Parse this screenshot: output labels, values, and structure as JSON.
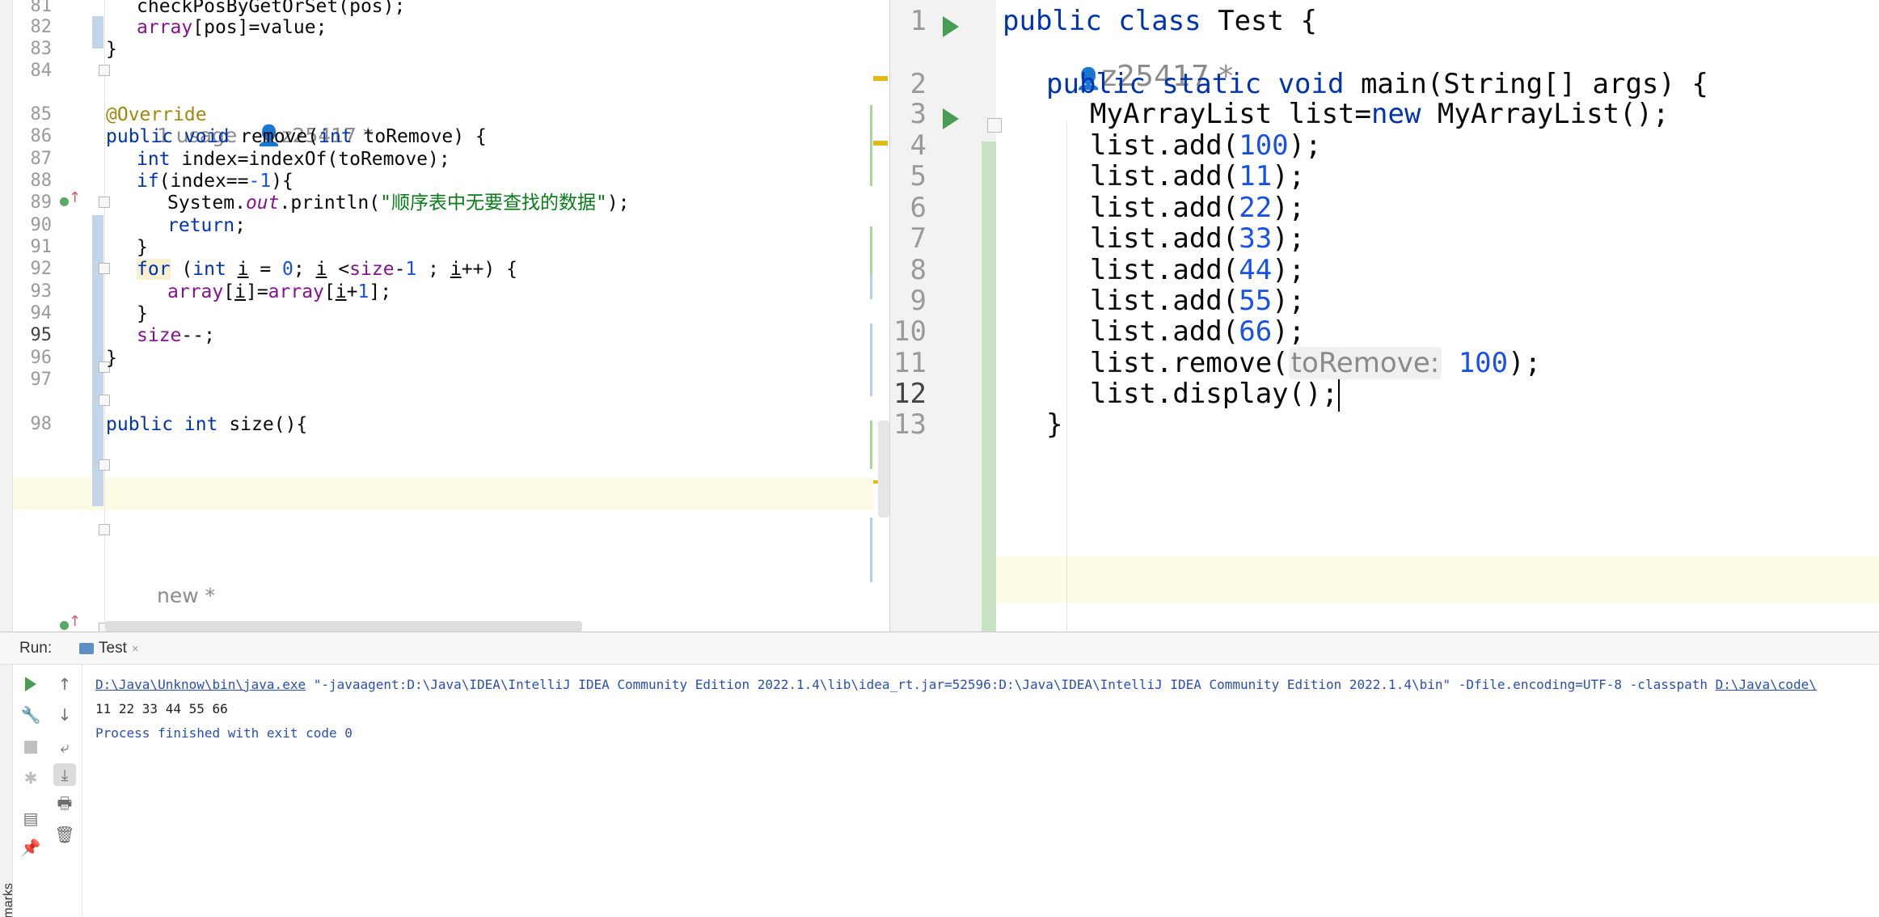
{
  "left_editor": {
    "lines": [
      {
        "no": "81",
        "code": [
          {
            "t": "checkPosByGetOrSet(pos);"
          }
        ]
      },
      {
        "no": "82",
        "code": [
          {
            "t": "array",
            "c": "fld"
          },
          {
            "t": "[pos]=value;"
          }
        ]
      },
      {
        "no": "83",
        "code": [
          {
            "t": "}"
          }
        ]
      },
      {
        "no": "84",
        "code": []
      },
      {
        "no": "85",
        "code": [
          {
            "t": "@Override",
            "c": "ann"
          }
        ]
      },
      {
        "no": "86",
        "code": [
          {
            "t": "public void ",
            "c": "kw"
          },
          {
            "t": "remove("
          },
          {
            "t": "int ",
            "c": "kw"
          },
          {
            "t": "toRemove) {"
          }
        ]
      },
      {
        "no": "87",
        "code": [
          {
            "t": "int ",
            "c": "kw"
          },
          {
            "t": "index=indexOf(toRemove);"
          }
        ]
      },
      {
        "no": "88",
        "code": [
          {
            "t": "if",
            "c": "kw"
          },
          {
            "t": "(index=="
          },
          {
            "t": "-1",
            "c": "num"
          },
          {
            "t": "){"
          }
        ]
      },
      {
        "no": "89",
        "code": [
          {
            "t": "System."
          },
          {
            "t": "out",
            "c": "sfld"
          },
          {
            "t": ".println("
          },
          {
            "t": "\"顺序表中无要查找的数据\"",
            "c": "str"
          },
          {
            "t": ");"
          }
        ]
      },
      {
        "no": "90",
        "code": [
          {
            "t": "return",
            "c": "kw"
          },
          {
            "t": ";"
          }
        ]
      },
      {
        "no": "91",
        "code": [
          {
            "t": "}"
          }
        ]
      },
      {
        "no": "92",
        "code": [
          {
            "t": "for",
            "c": "kw hlk"
          },
          {
            "t": " ("
          },
          {
            "t": "int ",
            "c": "kw"
          },
          {
            "t": "i",
            "c": "ul"
          },
          {
            "t": " = "
          },
          {
            "t": "0",
            "c": "num"
          },
          {
            "t": "; "
          },
          {
            "t": "i",
            "c": "ul"
          },
          {
            "t": " <"
          },
          {
            "t": "size",
            "c": "fld"
          },
          {
            "t": "-"
          },
          {
            "t": "1",
            "c": "num"
          },
          {
            "t": " ; "
          },
          {
            "t": "i",
            "c": "ul"
          },
          {
            "t": "++) {"
          }
        ]
      },
      {
        "no": "93",
        "code": [
          {
            "t": "array",
            "c": "fld"
          },
          {
            "t": "["
          },
          {
            "t": "i",
            "c": "ul"
          },
          {
            "t": "]="
          },
          {
            "t": "array",
            "c": "fld"
          },
          {
            "t": "["
          },
          {
            "t": "i",
            "c": "ul"
          },
          {
            "t": "+"
          },
          {
            "t": "1",
            "c": "num"
          },
          {
            "t": "];"
          }
        ]
      },
      {
        "no": "94",
        "code": [
          {
            "t": "}"
          }
        ]
      },
      {
        "no": "95",
        "code": [
          {
            "t": "size",
            "c": "fld"
          },
          {
            "t": "--;"
          }
        ]
      },
      {
        "no": "96",
        "code": [
          {
            "t": "}"
          }
        ]
      },
      {
        "no": "97",
        "code": []
      },
      {
        "no": "98",
        "code": [
          {
            "t": "public int ",
            "c": "kw"
          },
          {
            "t": "size(){"
          }
        ]
      }
    ],
    "inlay_usage": "1 usage",
    "inlay_author": "z25417 *",
    "inlay_new": "new *"
  },
  "right_editor": {
    "lines": [
      {
        "no": "1",
        "code": [
          {
            "t": "public class ",
            "c": "kw"
          },
          {
            "t": "Test {"
          }
        ]
      },
      {
        "no": "2",
        "code": [
          {
            "t": "public static void ",
            "c": "kw"
          },
          {
            "t": "main(String[] args) {"
          }
        ]
      },
      {
        "no": "3",
        "code": [
          {
            "t": "MyArrayList list="
          },
          {
            "t": "new ",
            "c": "kw"
          },
          {
            "t": "MyArrayList();"
          }
        ]
      },
      {
        "no": "4",
        "code": [
          {
            "t": "list.add("
          },
          {
            "t": "100",
            "c": "num"
          },
          {
            "t": ");"
          }
        ]
      },
      {
        "no": "5",
        "code": [
          {
            "t": "list.add("
          },
          {
            "t": "11",
            "c": "num"
          },
          {
            "t": ");"
          }
        ]
      },
      {
        "no": "6",
        "code": [
          {
            "t": "list.add("
          },
          {
            "t": "22",
            "c": "num"
          },
          {
            "t": ");"
          }
        ]
      },
      {
        "no": "7",
        "code": [
          {
            "t": "list.add("
          },
          {
            "t": "33",
            "c": "num"
          },
          {
            "t": ");"
          }
        ]
      },
      {
        "no": "8",
        "code": [
          {
            "t": "list.add("
          },
          {
            "t": "44",
            "c": "num"
          },
          {
            "t": ");"
          }
        ]
      },
      {
        "no": "9",
        "code": [
          {
            "t": "list.add("
          },
          {
            "t": "55",
            "c": "num"
          },
          {
            "t": ");"
          }
        ]
      },
      {
        "no": "10",
        "code": [
          {
            "t": "list.add("
          },
          {
            "t": "66",
            "c": "num"
          },
          {
            "t": ");"
          }
        ]
      },
      {
        "no": "11",
        "code": [
          {
            "t": "list.remove("
          },
          {
            "t": "toRemove:",
            "c": "hint"
          },
          {
            "t": " "
          },
          {
            "t": "100",
            "c": "num"
          },
          {
            "t": ");"
          }
        ]
      },
      {
        "no": "12",
        "code": [
          {
            "t": "list.display();"
          }
        ]
      },
      {
        "no": "13",
        "code": [
          {
            "t": "}"
          }
        ]
      }
    ],
    "inlay_author": "z25417 *"
  },
  "run_panel": {
    "label": "Run:",
    "tab_label": "Test",
    "tab_close": "×",
    "bookmarks_label": "Bookmarks",
    "console": {
      "cmd_java": "D:\\Java\\Unknow\\bin\\java.exe",
      "cmd_args": " \"-javaagent:D:\\Java\\IDEA\\IntelliJ IDEA Community Edition 2022.1.4\\lib\\idea_rt.jar=52596:D:\\Java\\IDEA\\IntelliJ IDEA Community Edition 2022.1.4\\bin\" -Dfile.encoding=UTF-8 -classpath ",
      "cmd_classpath": "D:\\Java\\code\\",
      "output": "11 22 33 44 55 66",
      "exit": "Process finished with exit code 0"
    },
    "icons": {
      "rerun": "rerun-icon",
      "up": "arrow-up-icon",
      "wrench": "wrench-icon",
      "down": "arrow-down-icon",
      "stop": "stop-icon",
      "wrap": "soft-wrap-icon",
      "debug": "debug-icon",
      "scroll_end": "scroll-to-end-icon",
      "print": "print-icon",
      "layout": "layout-icon",
      "trash": "trash-icon",
      "pin": "pin-icon"
    }
  }
}
